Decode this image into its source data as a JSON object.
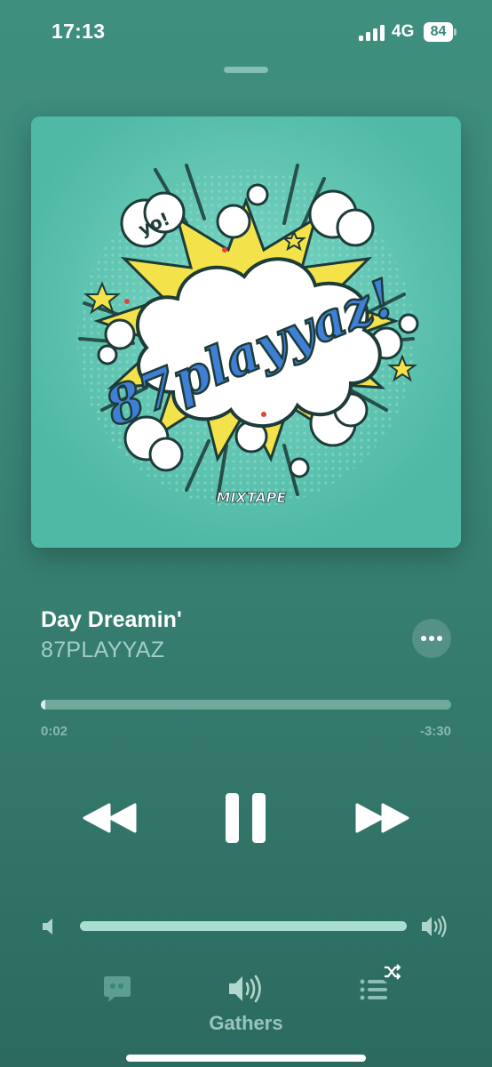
{
  "status_bar": {
    "time": "17:13",
    "network": "4G",
    "battery": "84"
  },
  "artwork": {
    "title_text": "87playyaz!",
    "badge_text": "yo!",
    "footer_text": "MIXTAPE",
    "background_color": "#58c4b0"
  },
  "now_playing": {
    "title": "Day Dreamin'",
    "artist": "87PLAYYAZ",
    "more_icon": "ellipsis-icon"
  },
  "progress": {
    "elapsed": "0:02",
    "remaining": "-3:30",
    "fraction": 0.01
  },
  "controls": {
    "rewind_icon": "rewind-icon",
    "pause_icon": "pause-icon",
    "forward_icon": "fast-forward-icon"
  },
  "volume": {
    "level": 1.0
  },
  "bottom_bar": {
    "lyrics_icon": "lyrics-quote-icon",
    "airplay_icon": "speaker-icon",
    "queue_icon": "queue-list-icon",
    "shuffle_icon": "shuffle-icon",
    "output_device": "Gathers"
  },
  "colors": {
    "background_top": "#3f8f7f",
    "background_bottom": "#2c6a5f",
    "accent_text": "#ffffff"
  }
}
